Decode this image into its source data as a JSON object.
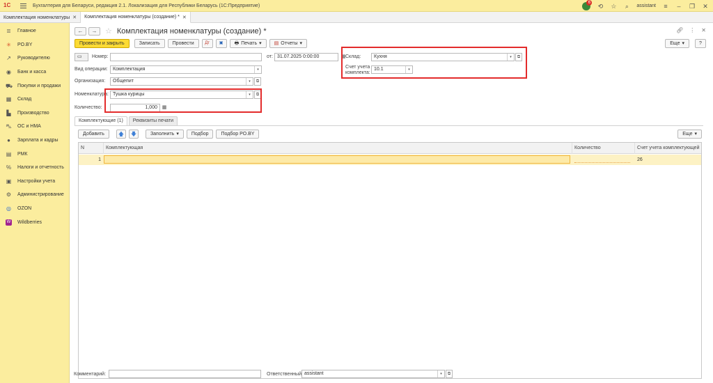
{
  "app": {
    "logo": "1С",
    "title": "Бухгалтерия для Беларуси, редакция 2.1. Локализация для Республики Беларусь   (1С:Предприятие)",
    "notifications_count": "6",
    "user": "assistant"
  },
  "tabs": [
    {
      "label": "Комплектация номенклатуры"
    },
    {
      "label": "Комплектация номенклатуры (создание) *"
    }
  ],
  "sidebar": {
    "items": [
      {
        "label": "Главное",
        "icon": "menu-icon"
      },
      {
        "label": "PO.BY",
        "icon": "asterisk-icon"
      },
      {
        "label": "Руководителю",
        "icon": "trend-icon"
      },
      {
        "label": "Банк и касса",
        "icon": "bank-icon"
      },
      {
        "label": "Покупки и продажи",
        "icon": "cart-icon"
      },
      {
        "label": "Склад",
        "icon": "warehouse-icon"
      },
      {
        "label": "Производство",
        "icon": "factory-icon"
      },
      {
        "label": "ОС и НМА",
        "icon": "truck-icon"
      },
      {
        "label": "Зарплата и кадры",
        "icon": "person-icon"
      },
      {
        "label": "РМК",
        "icon": "register-icon"
      },
      {
        "label": "Налоги и отчетность",
        "icon": "tax-icon"
      },
      {
        "label": "Настройки учета",
        "icon": "settings-doc-icon"
      },
      {
        "label": "Администрирование",
        "icon": "gear-icon"
      },
      {
        "label": "OZON",
        "icon": "ozon-icon"
      },
      {
        "label": "Wildberries",
        "icon": "wildberries-icon"
      }
    ]
  },
  "doc": {
    "title": "Комплектация номенклатуры (создание) *"
  },
  "toolbar": {
    "post_close": "Провести и закрыть",
    "save": "Записать",
    "post": "Провести",
    "print": "Печать",
    "reports": "Отчеты",
    "more": "Еще",
    "help": "?"
  },
  "form": {
    "number_label": "Номер:",
    "number_value": "",
    "date_label": "от:",
    "date_value": "31.07.2025  0:00:00",
    "operation_label": "Вид операции:",
    "operation_value": "Комплектация",
    "org_label": "Организация:",
    "org_value": "Общепит",
    "nomenclature_label": "Номенклатура:",
    "nomenclature_value": "Тушка курицы",
    "quantity_label": "Количество:",
    "quantity_value": "1,000",
    "warehouse_label": "Склад:",
    "warehouse_value": "Кухня",
    "account_label_line1": "Счет учета",
    "account_label_line2": "комплекта:",
    "account_value": "10.1"
  },
  "form_tabs": [
    {
      "label": "Комплектующие (1)"
    },
    {
      "label": "Реквизиты печати"
    }
  ],
  "table_toolbar": {
    "add": "Добавить",
    "fill": "Заполнить",
    "pick": "Подбор",
    "pick_poby": "Подбор PO.BY",
    "more": "Еще"
  },
  "table": {
    "columns": [
      "N",
      "Комплектующая",
      "Количество",
      "Счет учета комплектующей"
    ],
    "rows": [
      {
        "n": "1",
        "component": "",
        "quantity": "",
        "account": "26"
      }
    ]
  },
  "footer": {
    "comment_label": "Комментарий:",
    "comment_value": "",
    "responsible_label": "Ответственный:",
    "responsible_value": "assistant"
  },
  "colors": {
    "sidebar_bg": "#fbed9e",
    "primary_button": "#fcdb34",
    "highlight_box": "#e32b2b",
    "selected_row": "#fdf2c4"
  }
}
